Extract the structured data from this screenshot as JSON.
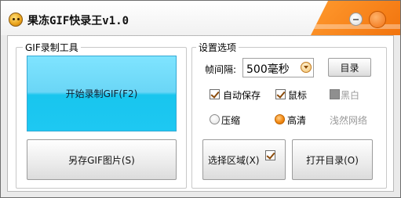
{
  "window": {
    "title": "果冻GIF快录王v1.0"
  },
  "left_group": {
    "legend": "GIF录制工具",
    "record_button": "开始录制GIF(F2)",
    "save_button": "另存GIF图片(S)"
  },
  "right_group": {
    "legend": "设置选项",
    "interval_label": "帧间隔:",
    "interval_value": "500毫秒",
    "directory_button": "目录",
    "auto_save_label": "自动保存",
    "auto_save_checked": true,
    "mouse_label": "鼠标",
    "mouse_checked": true,
    "bw_label": "黑白",
    "bw_checked": false,
    "compress_label": "压缩",
    "compress_selected": false,
    "hd_label": "高清",
    "hd_selected": true,
    "brand_label": "浅然网络",
    "select_area_button": "选择区域(X)",
    "select_area_checked": true,
    "open_dir_button": "打开目录(O)"
  },
  "colors": {
    "accent": "#f07c16",
    "record_button_top": "#7fe4ff",
    "record_button_bottom": "#1ec8f2",
    "window_bg": "#eaeaea"
  },
  "icons": {
    "app": "smiley-app-icon",
    "minimize": "minimize-icon",
    "close": "close-icon",
    "dropdown": "chevron-down-icon"
  }
}
